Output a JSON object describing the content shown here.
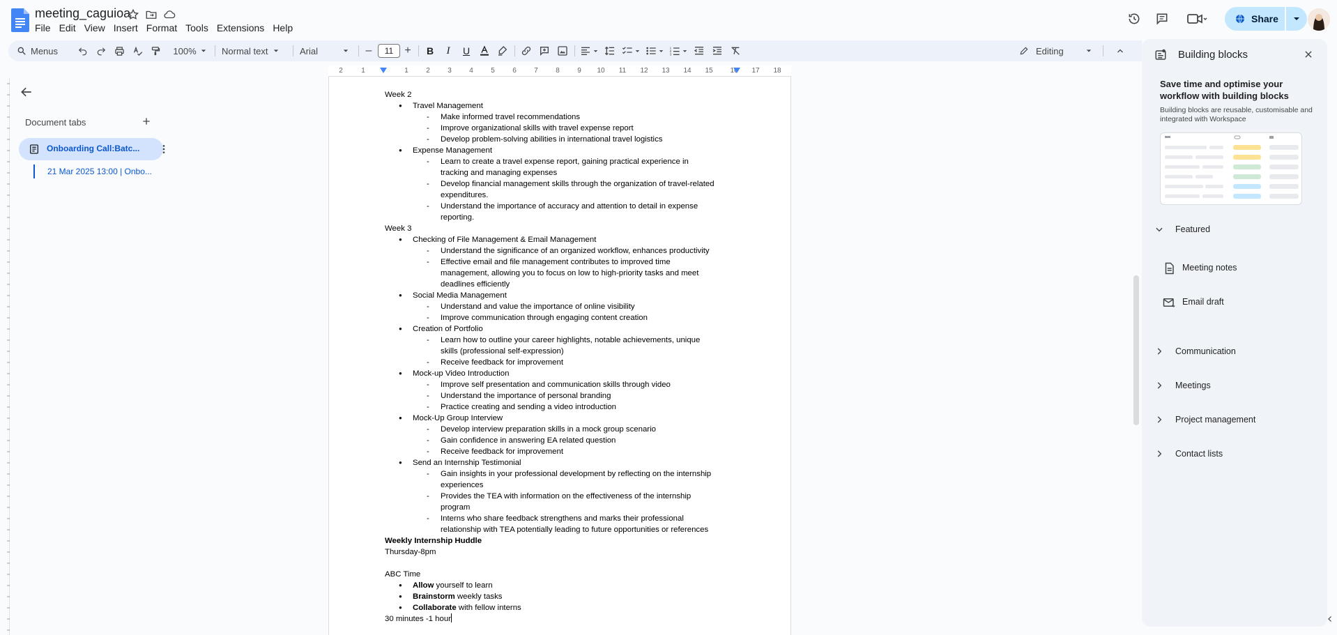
{
  "app": {
    "doc_title": "meeting_caguioa",
    "menu": [
      "File",
      "Edit",
      "View",
      "Insert",
      "Format",
      "Tools",
      "Extensions",
      "Help"
    ],
    "share_label": "Share"
  },
  "toolbar": {
    "menus_label": "Menus",
    "zoom": "100%",
    "style": "Normal text",
    "font": "Arial",
    "font_size": "11",
    "mode": "Editing"
  },
  "left_panel": {
    "heading": "Document tabs",
    "active_tab": "Onboarding Call:Batc...",
    "subheading": "21 Mar 2025 13:00 | Onbo..."
  },
  "ruler": [
    "2",
    "1",
    "1",
    "2",
    "3",
    "4",
    "5",
    "6",
    "7",
    "8",
    "9",
    "10",
    "11",
    "12",
    "13",
    "14",
    "15",
    "16",
    "17",
    "18"
  ],
  "document": {
    "week2": "Week 2",
    "travel_mgmt": "Travel Management",
    "tm1": "Make informed travel recommendations",
    "tm2": "Improve organizational skills with travel expense report",
    "tm3": "Develop problem-solving abilities in international travel logistics",
    "expense_mgmt": "Expense Management",
    "em1a": "Learn to create a travel expense report, gaining practical experience in",
    "em1b": "tracking and managing expenses",
    "em2a": "Develop financial management skills through the organization of travel-related",
    "em2b": "expenditures.",
    "em3a": "Understand the importance of accuracy and attention to detail in expense",
    "em3b": "reporting.",
    "week3": "Week 3",
    "file_email": "Checking of File Management & Email Management",
    "fe1": "Understand the significance of an organized workflow, enhances productivity",
    "fe2a": "Effective email and file management contributes to improved time",
    "fe2b": "management, allowing you to focus on low to high-priority tasks and meet",
    "fe2c": "deadlines efficiently",
    "social": "Social Media Management",
    "sm1": "Understand and value the importance of online visibility",
    "sm2": "Improve communication through engaging content creation",
    "portfolio": "Creation of Portfolio",
    "cp1a": "Learn how to outline your career highlights, notable achievements, unique",
    "cp1b": "skills (professional self-expression)",
    "cp2": "Receive feedback for improvement",
    "mockup_video": "Mock-up Video Introduction",
    "mv1": "Improve self presentation and communication skills through video",
    "mv2": "Understand the importance of personal branding",
    "mv3": "Practice creating and sending a video introduction",
    "group_interview": "Mock-Up Group Interview",
    "gi1": "Develop interview preparation skills in a mock group scenario",
    "gi2": "Gain confidence in answering EA related question",
    "gi3": "Receive feedback for improvement",
    "testimonial": "Send an Internship Testimonial",
    "st1a": "Gain insights in your professional development by reflecting on the internship",
    "st1b": "experiences",
    "st2a": "Provides the TEA with information on the effectiveness of the internship",
    "st2b": "program",
    "st3a": "Interns who share feedback strengthens and marks their professional",
    "st3b": "relationship with TEA potentially leading to future opportunities or references",
    "huddle_title": "Weekly Internship Huddle",
    "huddle_time": "Thursday-8pm",
    "abc_time": "ABC Time",
    "abc1_bold": "Allow",
    "abc1_rest": " yourself to learn",
    "abc2_bold": "Brainstorm",
    "abc2_rest": " weekly tasks",
    "abc3_bold": "Collaborate",
    "abc3_rest": " with fellow interns",
    "duration": "30 minutes -1 hour"
  },
  "side_panel": {
    "title": "Building blocks",
    "heading": "Save time and optimise your workflow with building blocks",
    "description": "Building blocks are reusable, customisable and integrated with Workspace",
    "featured": "Featured",
    "featured_items": [
      "Meeting notes",
      "Email draft"
    ],
    "sections": [
      "Communication",
      "Meetings",
      "Project management",
      "Contact lists"
    ]
  },
  "colors": {
    "accent": "#0b57d0",
    "share_bg": "#c2e7ff",
    "active_tab_bg": "#d3e3fd"
  }
}
